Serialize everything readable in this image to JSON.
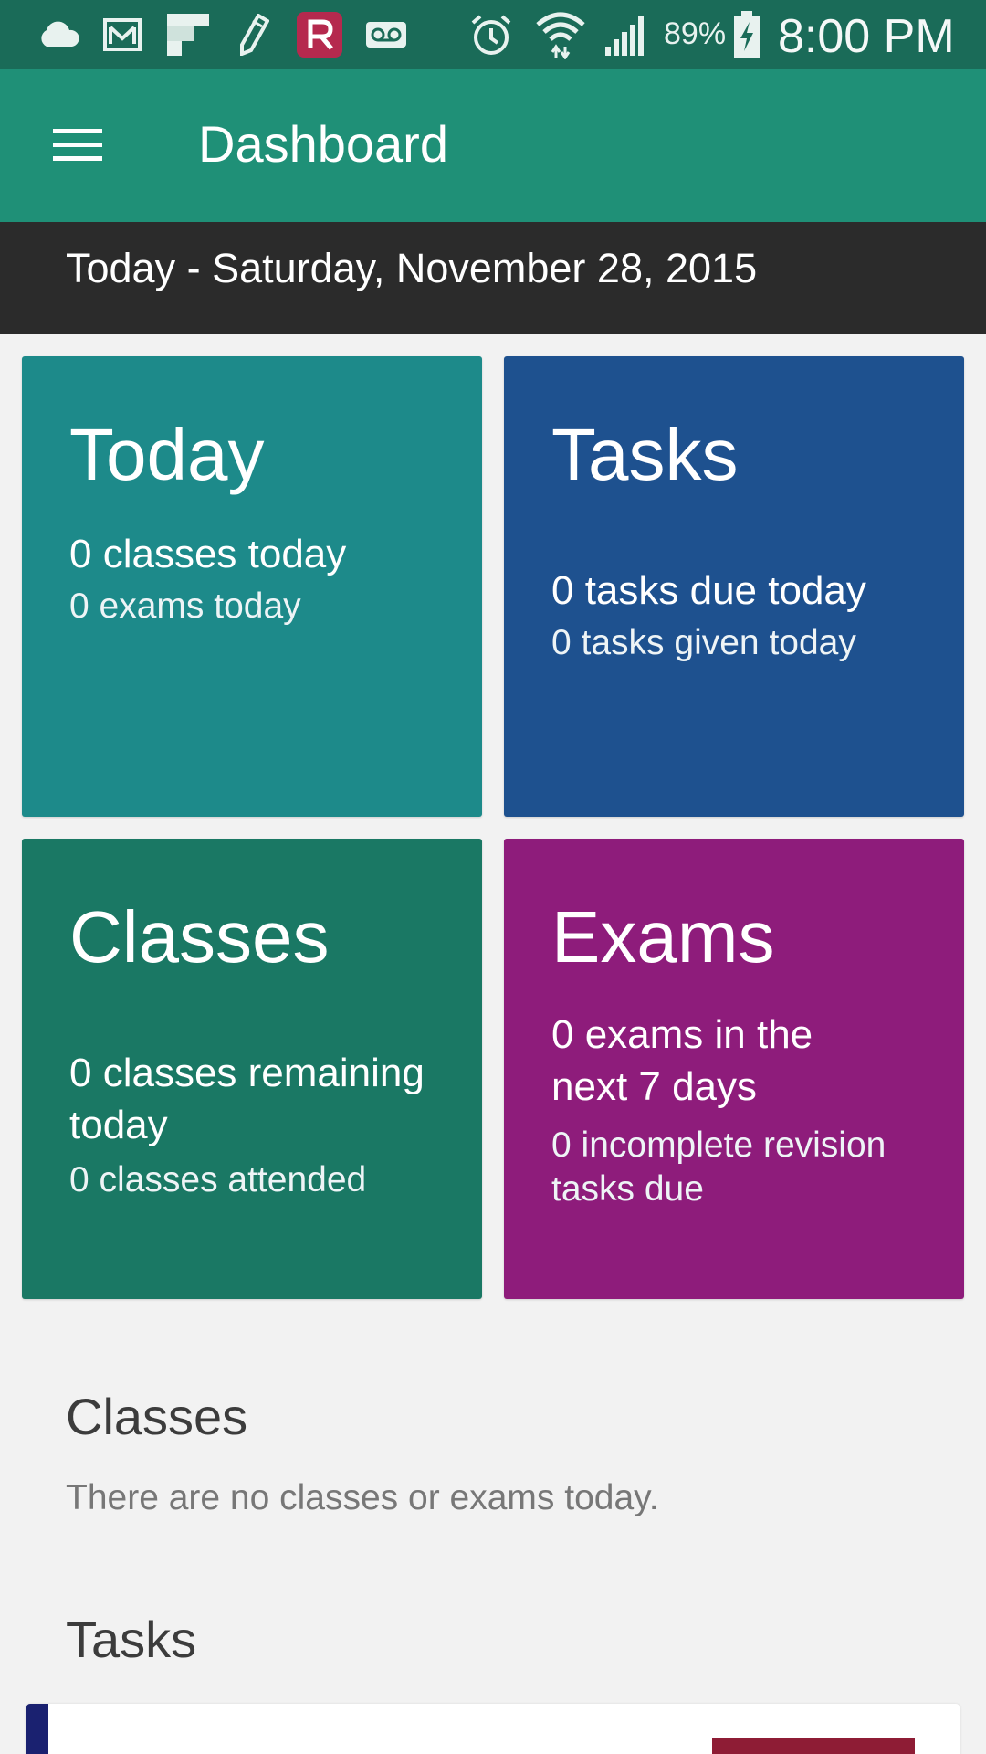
{
  "status_bar": {
    "battery_percent": "89%",
    "time": "8:00 PM",
    "icons": [
      "cloud-icon",
      "gmail-icon",
      "flipboard-icon",
      "pencil-icon",
      "r-app-icon",
      "voicemail-icon",
      "alarm-icon",
      "wifi-icon",
      "signal-icon",
      "battery-charging-icon"
    ],
    "colors": {
      "background": "#1a6b58",
      "r_app": "#b5294e"
    }
  },
  "app_bar": {
    "title": "Dashboard",
    "menu_icon": "hamburger-menu-icon",
    "color": "#1f9077"
  },
  "date_bar": {
    "text": "Today - Saturday, November 28, 2015",
    "color": "#2b2b2b"
  },
  "tiles": {
    "today": {
      "title": "Today",
      "line1": "0 classes today",
      "line2": "0 exams today",
      "color": "#1d8a8a"
    },
    "tasks": {
      "title": "Tasks",
      "line1": "0 tasks due today",
      "line2": "0 tasks given today",
      "color": "#1e518f"
    },
    "classes": {
      "title": "Classes",
      "line1": "0 classes remaining today",
      "line2": "0 classes attended",
      "color": "#1a7864"
    },
    "exams": {
      "title": "Exams",
      "line1": "0 exams in the next 7 days",
      "line2": "0 incomplete revision tasks due",
      "color": "#8e1c7b"
    }
  },
  "sections": {
    "classes": {
      "title": "Classes",
      "empty_message": "There are no classes or exams today."
    },
    "tasks": {
      "title": "Tasks"
    }
  },
  "task_card": {
    "accent_color": "#1a2170",
    "badge_color": "#8e1c35"
  }
}
